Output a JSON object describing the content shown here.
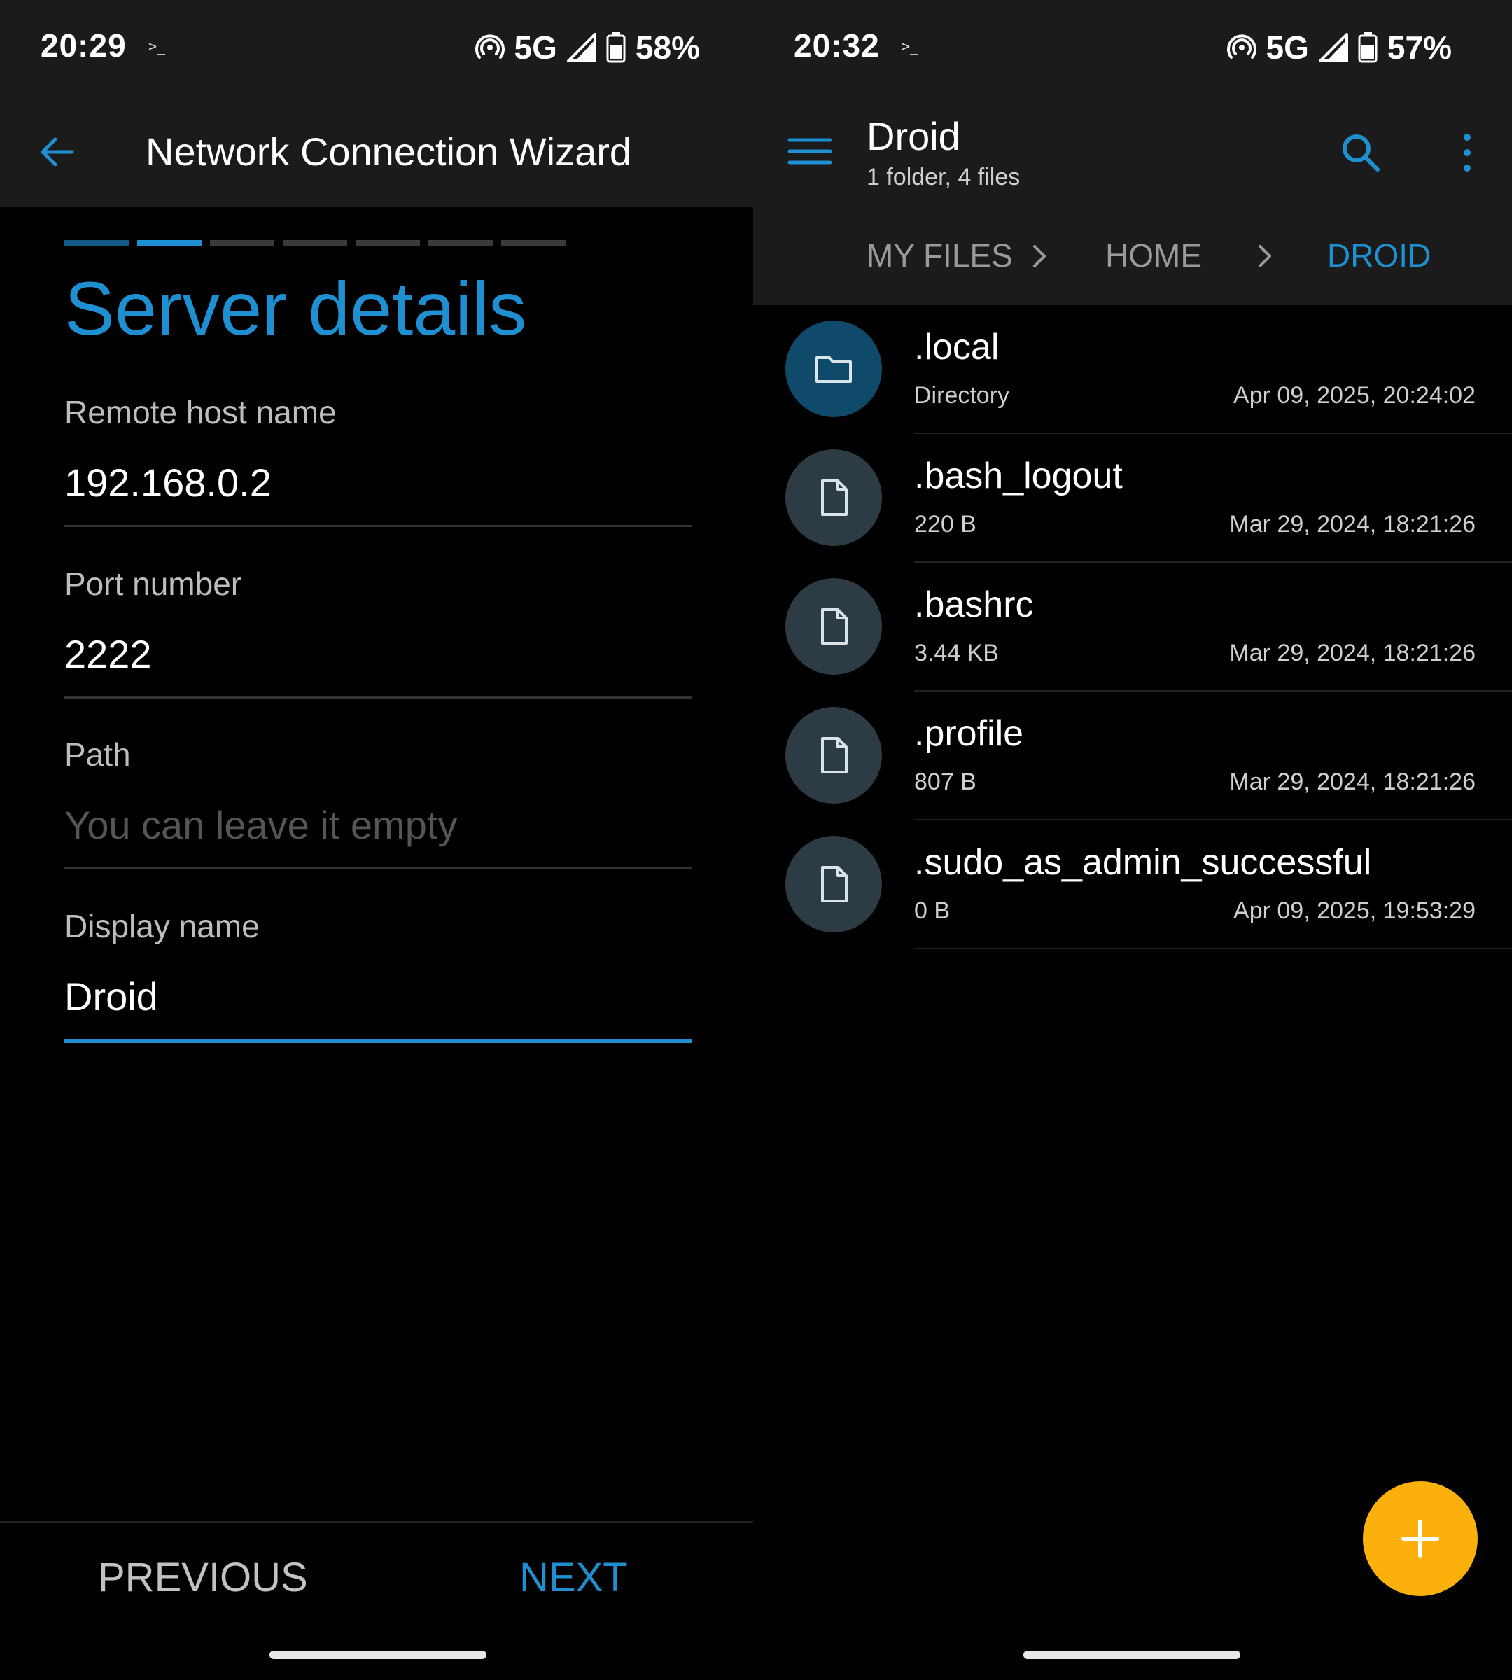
{
  "left": {
    "status": {
      "time": "20:29",
      "term_glyph": ">_",
      "network": "5G",
      "battery": "58%"
    },
    "appbar": {
      "title": "Network Connection Wizard"
    },
    "wizard": {
      "steps_total": 7,
      "steps_done": 1,
      "active_step": 2,
      "heading": "Server details",
      "fields": {
        "host": {
          "label": "Remote host name",
          "value": "192.168.0.2",
          "placeholder": ""
        },
        "port": {
          "label": "Port number",
          "value": "2222",
          "placeholder": ""
        },
        "path": {
          "label": "Path",
          "value": "",
          "placeholder": "You can leave it empty"
        },
        "display": {
          "label": "Display name",
          "value": "Droid",
          "placeholder": ""
        }
      }
    },
    "buttons": {
      "previous": "PREVIOUS",
      "next": "NEXT"
    }
  },
  "right": {
    "status": {
      "time": "20:32",
      "term_glyph": ">_",
      "network": "5G",
      "battery": "57%"
    },
    "appbar": {
      "title": "Droid",
      "subtitle": "1 folder, 4 files"
    },
    "breadcrumb": {
      "items": [
        "MY FILES",
        "HOME",
        "DROID"
      ]
    },
    "files": [
      {
        "name": ".local",
        "meta": "Directory",
        "date": "Apr 09, 2025, 20:24:02",
        "icon": "folder-icon"
      },
      {
        "name": ".bash_logout",
        "meta": "220 B",
        "date": "Mar 29, 2024, 18:21:26",
        "icon": "file-icon"
      },
      {
        "name": ".bashrc",
        "meta": "3.44 KB",
        "date": "Mar 29, 2024, 18:21:26",
        "icon": "file-icon"
      },
      {
        "name": ".profile",
        "meta": "807 B",
        "date": "Mar 29, 2024, 18:21:26",
        "icon": "file-icon"
      },
      {
        "name": ".sudo_as_admin_successful",
        "meta": "0 B",
        "date": "Apr 09, 2025, 19:53:29",
        "icon": "file-icon"
      }
    ],
    "fab": {
      "icon": "plus-icon"
    }
  },
  "colors": {
    "accent": "#1e8fd0",
    "fab": "#fbb00c",
    "bar": "#1b1b1b",
    "background": "#000000"
  }
}
